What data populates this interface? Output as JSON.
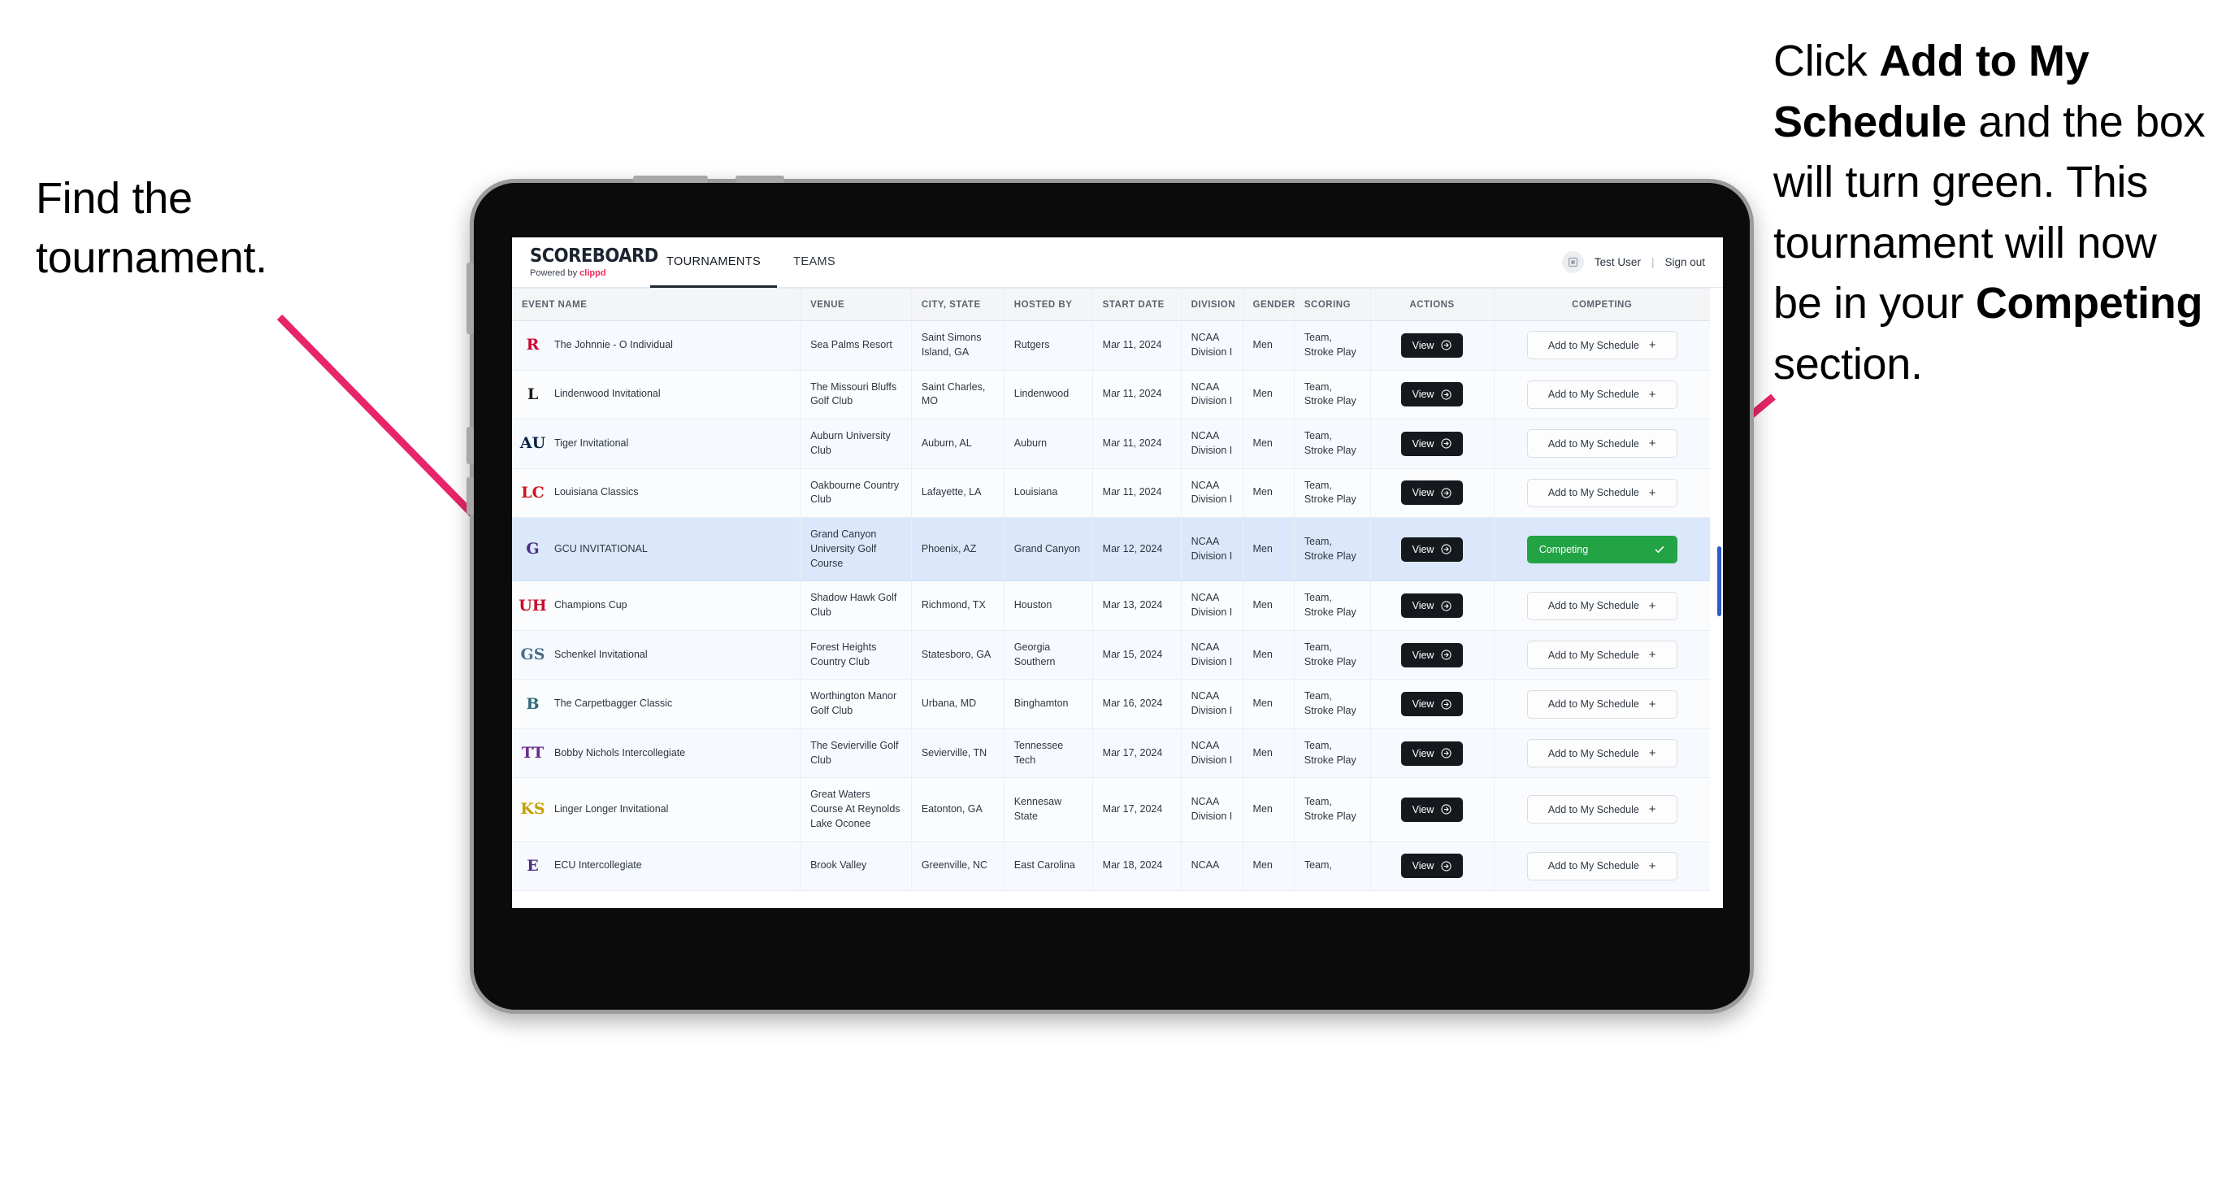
{
  "annotations": {
    "left": {
      "line1": "Find the",
      "line2": "tournament."
    },
    "right": {
      "seg1": "Click ",
      "bold1": "Add to My Schedule",
      "seg2": " and the box will turn green. This tournament will now be in your ",
      "bold2": "Competing",
      "seg3": " section."
    },
    "arrow_color": "#E8256A"
  },
  "app": {
    "brand": {
      "title": "SCOREBOARD",
      "powered_prefix": "Powered by ",
      "powered_brand": "clippd"
    },
    "tabs": [
      {
        "label": "TOURNAMENTS",
        "active": true
      },
      {
        "label": "TEAMS",
        "active": false
      }
    ],
    "user": {
      "name": "Test User",
      "separator": "|",
      "signout": "Sign out"
    },
    "table": {
      "columns": [
        "EVENT NAME",
        "VENUE",
        "CITY, STATE",
        "HOSTED BY",
        "START DATE",
        "DIVISION",
        "GENDER",
        "SCORING",
        "ACTIONS",
        "COMPETING"
      ],
      "view_label": "View",
      "add_label": "Add to My Schedule",
      "competing_label": "Competing",
      "rows": [
        {
          "event": "The Johnnie - O Individual",
          "venue": "Sea Palms Resort",
          "city": "Saint Simons Island, GA",
          "hosted_by": "Rutgers",
          "start_date": "Mar 11, 2024",
          "division": "NCAA Division I",
          "gender": "Men",
          "scoring": "Team, Stroke Play",
          "competing": false,
          "logo": {
            "text": "R",
            "color": "#cc0033",
            "bg": "transparent"
          }
        },
        {
          "event": "Lindenwood Invitational",
          "venue": "The Missouri Bluffs Golf Club",
          "city": "Saint Charles, MO",
          "hosted_by": "Lindenwood",
          "start_date": "Mar 11, 2024",
          "division": "NCAA Division I",
          "gender": "Men",
          "scoring": "Team, Stroke Play",
          "competing": false,
          "logo": {
            "text": "L",
            "color": "#1a1a1a",
            "bg": "transparent"
          }
        },
        {
          "event": "Tiger Invitational",
          "venue": "Auburn University Club",
          "city": "Auburn, AL",
          "hosted_by": "Auburn",
          "start_date": "Mar 11, 2024",
          "division": "NCAA Division I",
          "gender": "Men",
          "scoring": "Team, Stroke Play",
          "competing": false,
          "logo": {
            "text": "AU",
            "color": "#0c2340",
            "bg": "transparent"
          }
        },
        {
          "event": "Louisiana Classics",
          "venue": "Oakbourne Country Club",
          "city": "Lafayette, LA",
          "hosted_by": "Louisiana",
          "start_date": "Mar 11, 2024",
          "division": "NCAA Division I",
          "gender": "Men",
          "scoring": "Team, Stroke Play",
          "competing": false,
          "logo": {
            "text": "LC",
            "color": "#ce181e",
            "bg": "transparent"
          }
        },
        {
          "event": "GCU INVITATIONAL",
          "venue": "Grand Canyon University Golf Course",
          "city": "Phoenix, AZ",
          "hosted_by": "Grand Canyon",
          "start_date": "Mar 12, 2024",
          "division": "NCAA Division I",
          "gender": "Men",
          "scoring": "Team, Stroke Play",
          "competing": true,
          "selected": true,
          "logo": {
            "text": "G",
            "color": "#4b2e83",
            "bg": "transparent"
          }
        },
        {
          "event": "Champions Cup",
          "venue": "Shadow Hawk Golf Club",
          "city": "Richmond, TX",
          "hosted_by": "Houston",
          "start_date": "Mar 13, 2024",
          "division": "NCAA Division I",
          "gender": "Men",
          "scoring": "Team, Stroke Play",
          "competing": false,
          "logo": {
            "text": "UH",
            "color": "#c8102e",
            "bg": "transparent"
          }
        },
        {
          "event": "Schenkel Invitational",
          "venue": "Forest Heights Country Club",
          "city": "Statesboro, GA",
          "hosted_by": "Georgia Southern",
          "start_date": "Mar 15, 2024",
          "division": "NCAA Division I",
          "gender": "Men",
          "scoring": "Team, Stroke Play",
          "competing": false,
          "logo": {
            "text": "GS",
            "color": "#4a6d8c",
            "bg": "transparent"
          }
        },
        {
          "event": "The Carpetbagger Classic",
          "venue": "Worthington Manor Golf Club",
          "city": "Urbana, MD",
          "hosted_by": "Binghamton",
          "start_date": "Mar 16, 2024",
          "division": "NCAA Division I",
          "gender": "Men",
          "scoring": "Team, Stroke Play",
          "competing": false,
          "logo": {
            "text": "B",
            "color": "#2f6b7a",
            "bg": "transparent"
          }
        },
        {
          "event": "Bobby Nichols Intercollegiate",
          "venue": "The Sevierville Golf Club",
          "city": "Sevierville, TN",
          "hosted_by": "Tennessee Tech",
          "start_date": "Mar 17, 2024",
          "division": "NCAA Division I",
          "gender": "Men",
          "scoring": "Team, Stroke Play",
          "competing": false,
          "logo": {
            "text": "TT",
            "color": "#6b2d8b",
            "bg": "transparent"
          }
        },
        {
          "event": "Linger Longer Invitational",
          "venue": "Great Waters Course At Reynolds Lake Oconee",
          "city": "Eatonton, GA",
          "hosted_by": "Kennesaw State",
          "start_date": "Mar 17, 2024",
          "division": "NCAA Division I",
          "gender": "Men",
          "scoring": "Team, Stroke Play",
          "competing": false,
          "logo": {
            "text": "KS",
            "color": "#c5a000",
            "bg": "transparent"
          }
        },
        {
          "event": "ECU Intercollegiate",
          "venue": "Brook Valley",
          "city": "Greenville, NC",
          "hosted_by": "East Carolina",
          "start_date": "Mar 18, 2024",
          "division": "NCAA",
          "gender": "Men",
          "scoring": "Team,",
          "competing": false,
          "partial": true,
          "logo": {
            "text": "E",
            "color": "#4b2e83",
            "bg": "transparent"
          }
        }
      ]
    }
  }
}
